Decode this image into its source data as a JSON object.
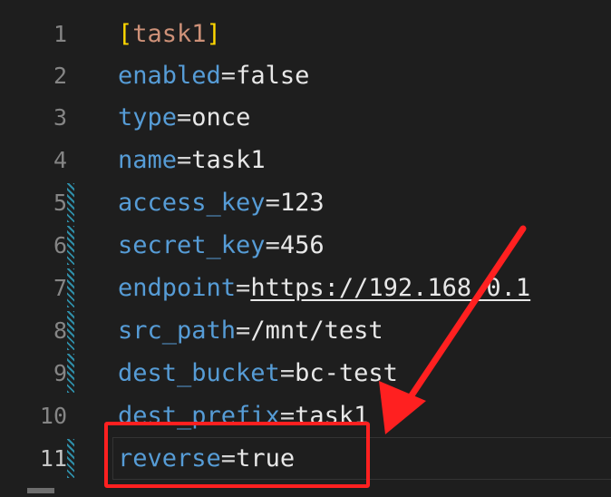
{
  "editor": {
    "lines": [
      {
        "num": "1",
        "key": "",
        "eq": "",
        "val": "",
        "section": "task1"
      },
      {
        "num": "2",
        "key": "enabled",
        "eq": "=",
        "val": "false"
      },
      {
        "num": "3",
        "key": "type",
        "eq": "=",
        "val": "once"
      },
      {
        "num": "4",
        "key": "name",
        "eq": "=",
        "val": "task1"
      },
      {
        "num": "5",
        "key": "access_key",
        "eq": "=",
        "val": "123"
      },
      {
        "num": "6",
        "key": "secret_key",
        "eq": "=",
        "val": "456"
      },
      {
        "num": "7",
        "key": "endpoint",
        "eq": "=",
        "val": "https://192.168.0.1"
      },
      {
        "num": "8",
        "key": "src_path",
        "eq": "=",
        "val": "/mnt/test"
      },
      {
        "num": "9",
        "key": "dest_bucket",
        "eq": "=",
        "val": "bc-test"
      },
      {
        "num": "10",
        "key": "dest_prefix",
        "eq": "=",
        "val": "task1"
      },
      {
        "num": "11",
        "key": "reverse",
        "eq": "=",
        "val": "true"
      }
    ],
    "section_open": "[",
    "section_close": "]",
    "annotation_color": "#ff2020"
  }
}
